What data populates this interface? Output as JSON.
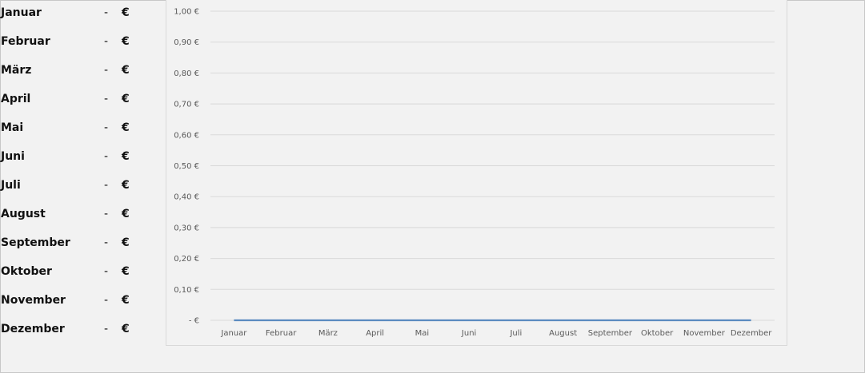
{
  "month_table": [
    {
      "name": "Januar",
      "dash": "-",
      "currency": "€"
    },
    {
      "name": "Februar",
      "dash": "-",
      "currency": "€"
    },
    {
      "name": "März",
      "dash": "-",
      "currency": "€"
    },
    {
      "name": "April",
      "dash": "-",
      "currency": "€"
    },
    {
      "name": "Mai",
      "dash": "-",
      "currency": "€"
    },
    {
      "name": "Juni",
      "dash": "-",
      "currency": "€"
    },
    {
      "name": "Juli",
      "dash": "-",
      "currency": "€"
    },
    {
      "name": "August",
      "dash": "-",
      "currency": "€"
    },
    {
      "name": "September",
      "dash": "-",
      "currency": "€"
    },
    {
      "name": "Oktober",
      "dash": "-",
      "currency": "€"
    },
    {
      "name": "November",
      "dash": "-",
      "currency": "€"
    },
    {
      "name": "Dezember",
      "dash": "-",
      "currency": "€"
    }
  ],
  "chart_data": {
    "type": "line",
    "title": "",
    "xlabel": "",
    "ylabel": "",
    "categories": [
      "Januar",
      "Februar",
      "März",
      "April",
      "Mai",
      "Juni",
      "Juli",
      "August",
      "September",
      "Oktober",
      "November",
      "Dezember"
    ],
    "series": [
      {
        "values": [
          0,
          0,
          0,
          0,
          0,
          0,
          0,
          0,
          0,
          0,
          0,
          0
        ],
        "color": "#5b8bc0"
      }
    ],
    "ylim": [
      0,
      1
    ],
    "y_ticks": [
      0,
      0.1,
      0.2,
      0.3,
      0.4,
      0.5,
      0.6,
      0.7,
      0.8,
      0.9,
      1.0
    ],
    "y_tick_labels": [
      "-  €",
      "0,10 €",
      "0,20 €",
      "0,30 €",
      "0,40 €",
      "0,50 €",
      "0,60 €",
      "0,70 €",
      "0,80 €",
      "0,90 €",
      "1,00 €"
    ],
    "grid": true,
    "legend": "none"
  }
}
